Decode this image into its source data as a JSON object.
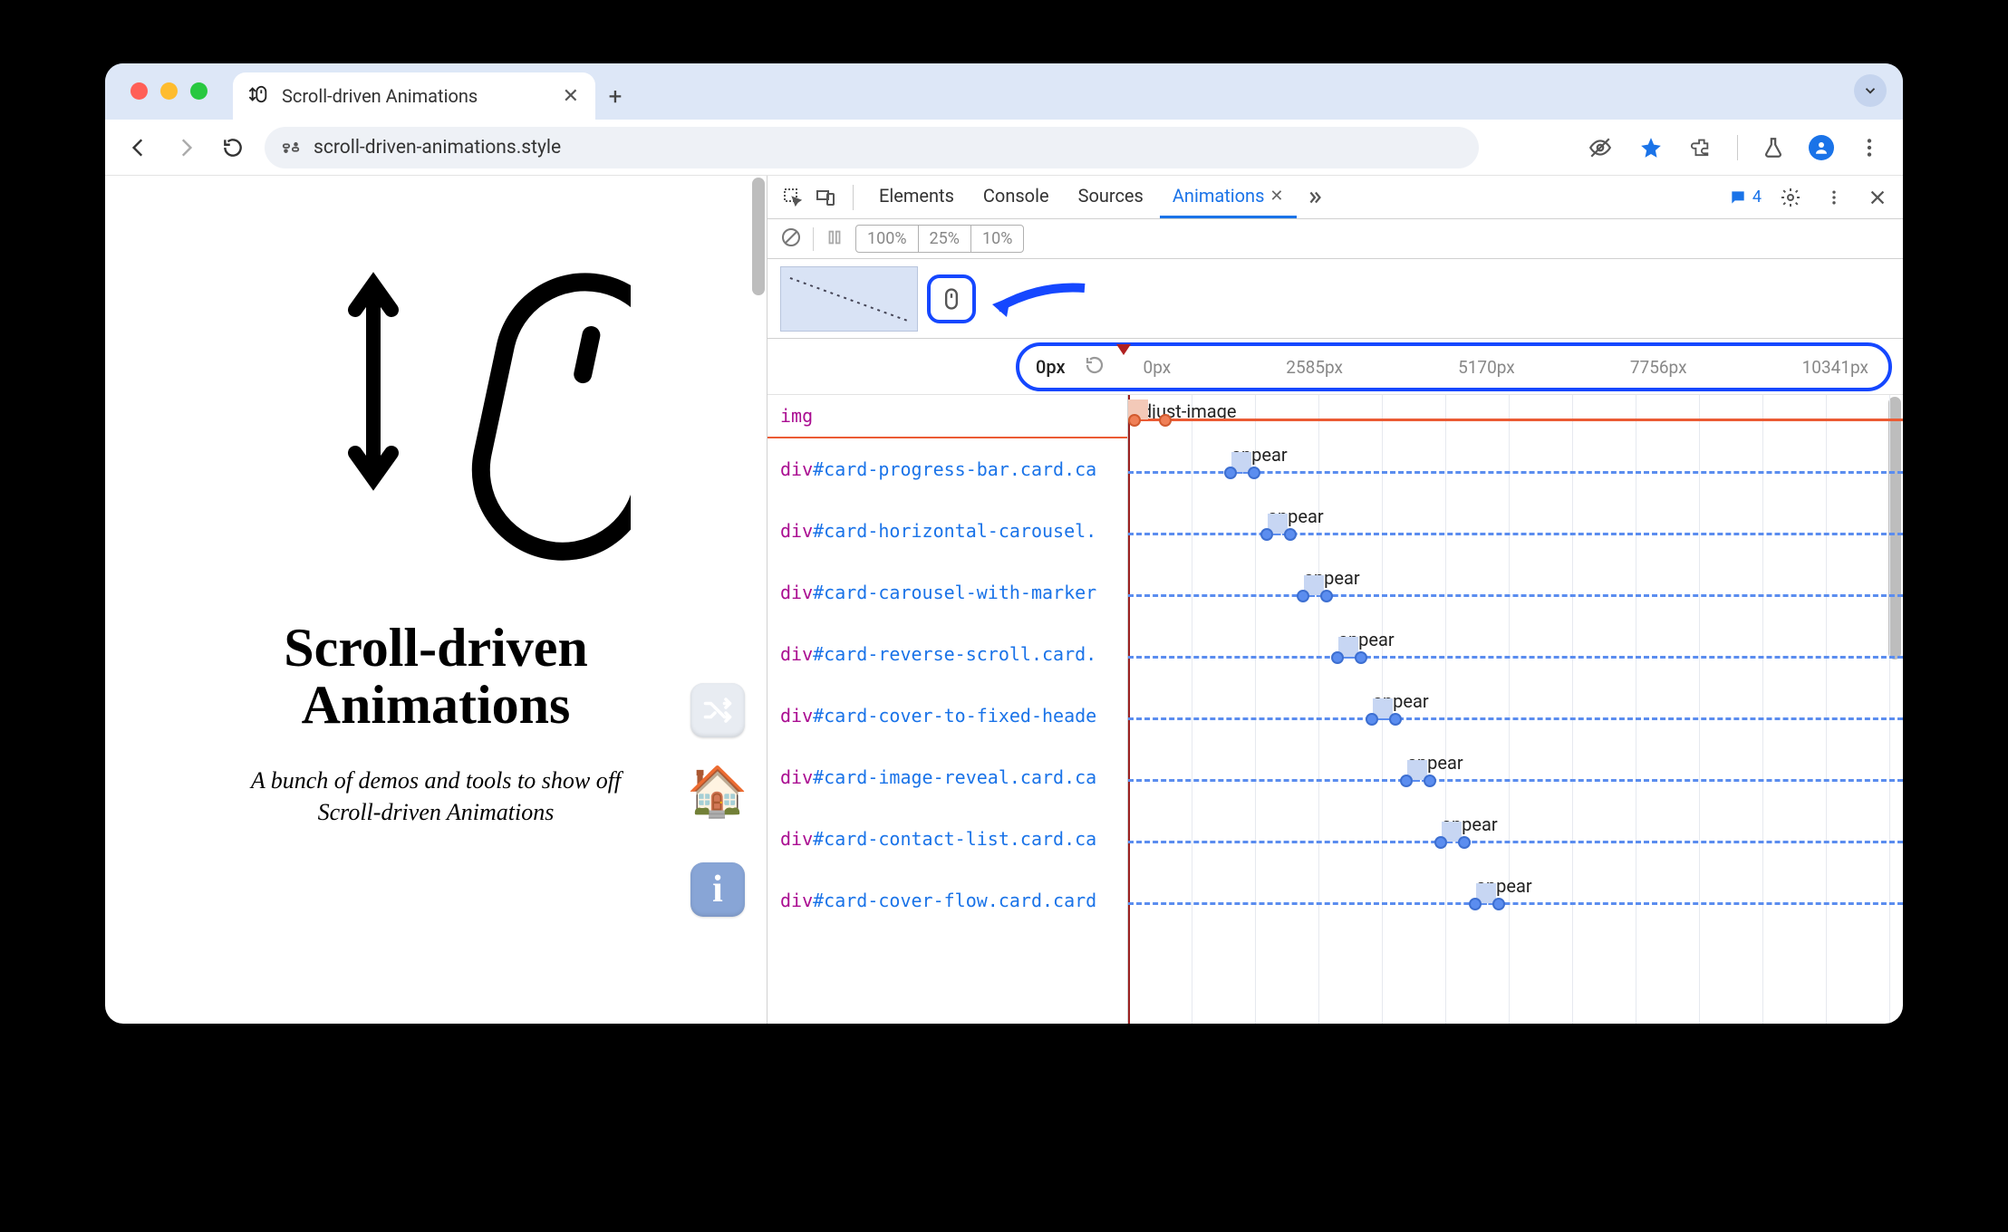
{
  "browser": {
    "tab_title": "Scroll-driven Animations",
    "url": "scroll-driven-animations.style",
    "new_tab_label": "+"
  },
  "page": {
    "title_line1": "Scroll-driven",
    "title_line2": "Animations",
    "subtitle_line1": "A bunch of demos and tools to show off",
    "subtitle_line2": "Scroll-driven Animations"
  },
  "devtools": {
    "tabs": [
      "Elements",
      "Console",
      "Sources",
      "Animations"
    ],
    "active_tab": "Animations",
    "issues_count": "4",
    "speeds": [
      "100%",
      "25%",
      "10%"
    ],
    "ruler": {
      "current": "0px",
      "ticks": [
        "0px",
        "2585px",
        "5170px",
        "7756px",
        "10341px"
      ]
    },
    "rows": [
      {
        "tag": "img",
        "id": "",
        "cls": "",
        "anim_name": "adjust-image",
        "offset": 0,
        "first": true
      },
      {
        "tag": "div",
        "id": "#card-progress-bar",
        "cls": ".card.ca",
        "anim_name": "appear",
        "offset": 110
      },
      {
        "tag": "div",
        "id": "#card-horizontal-carousel",
        "cls": ".",
        "anim_name": "appear",
        "offset": 150
      },
      {
        "tag": "div",
        "id": "#card-carousel-with-marker",
        "cls": "",
        "anim_name": "appear",
        "offset": 190
      },
      {
        "tag": "div",
        "id": "#card-reverse-scroll",
        "cls": ".card.",
        "anim_name": "appear",
        "offset": 228
      },
      {
        "tag": "div",
        "id": "#card-cover-to-fixed-heade",
        "cls": "",
        "anim_name": "appear",
        "offset": 266
      },
      {
        "tag": "div",
        "id": "#card-image-reveal",
        "cls": ".card.ca",
        "anim_name": "appear",
        "offset": 304
      },
      {
        "tag": "div",
        "id": "#card-contact-list",
        "cls": ".card.ca",
        "anim_name": "appear",
        "offset": 342
      },
      {
        "tag": "div",
        "id": "#card-cover-flow",
        "cls": ".card.card",
        "anim_name": "appear",
        "offset": 380
      }
    ]
  }
}
